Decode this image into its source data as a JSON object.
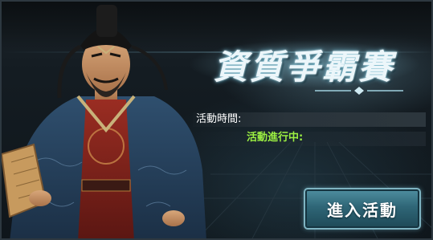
{
  "event": {
    "title": "資質爭霸賽",
    "time_label": "活動時間:",
    "status_label": "活動進行中:",
    "enter_button_label": "進入活動"
  },
  "colors": {
    "accent": "#7fb4c2",
    "status_green": "#9cf042",
    "title_glow": "#6fb6cc"
  }
}
